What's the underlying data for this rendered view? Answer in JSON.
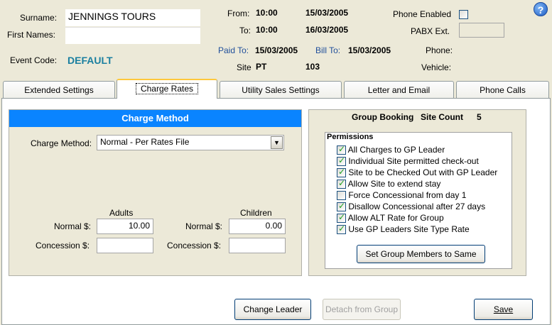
{
  "header": {
    "surname_label": "Surname:",
    "surname_value": "JENNINGS TOURS",
    "first_names_label": "First Names:",
    "first_names_value": "",
    "event_code_label": "Event Code:",
    "event_code_value": "DEFAULT",
    "from_label": "From:",
    "from_time": "10:00",
    "from_date": "15/03/2005",
    "to_label": "To:",
    "to_time": "10:00",
    "to_date": "16/03/2005",
    "paid_to_label": "Paid To:",
    "paid_to_value": "15/03/2005",
    "bill_to_label": "Bill To:",
    "bill_to_value": "15/03/2005",
    "site_label": "Site",
    "site_type": "PT",
    "site_number": "103",
    "phone_enabled_label": "Phone Enabled",
    "phone_enabled_checked": false,
    "pabx_label": "PABX Ext.",
    "pabx_value": "",
    "phone_label": "Phone:",
    "vehicle_label": "Vehicle:",
    "help_icon": "help-icon"
  },
  "tabs": [
    {
      "label": "Extended Settings"
    },
    {
      "label": "Charge Rates"
    },
    {
      "label": "Utility Sales Settings"
    },
    {
      "label": "Letter and Email"
    },
    {
      "label": "Phone Calls"
    }
  ],
  "active_tab": "Charge Rates",
  "charge_method": {
    "title": "Charge Method",
    "label": "Charge Method:",
    "selected": "Normal - Per Rates File",
    "adults_label": "Adults",
    "children_label": "Children",
    "adult_normal_label": "Normal $:",
    "adult_normal_value": "10.00",
    "adult_concession_label": "Concession $:",
    "adult_concession_value": "",
    "child_normal_label": "Normal $:",
    "child_normal_value": "0.00",
    "child_concession_label": "Concession $:",
    "child_concession_value": ""
  },
  "group_booking": {
    "title": "Group Booking",
    "site_count_label": "Site Count",
    "site_count_value": "5",
    "permissions_title": "Permissions",
    "permissions": [
      {
        "label": "All Charges to GP Leader",
        "checked": true
      },
      {
        "label": "Individual Site permitted check-out",
        "checked": true
      },
      {
        "label": "Site to be Checked Out with GP Leader",
        "checked": true
      },
      {
        "label": "Allow Site to extend stay",
        "checked": true
      },
      {
        "label": "Force Concessional from day 1",
        "checked": false
      },
      {
        "label": "Disallow Concessional after 27 days",
        "checked": true
      },
      {
        "label": "Allow ALT Rate for Group",
        "checked": true
      },
      {
        "label": "Use GP Leaders Site Type Rate",
        "checked": true
      }
    ],
    "set_members_button": "Set Group Members to Same"
  },
  "footer": {
    "change_leader_button": "Change Leader",
    "detach_button": "Detach from Group",
    "save_button": "Save"
  },
  "colors": {
    "window_bg": "#ece9d8",
    "section_header": "#0a84ff",
    "accent_teal": "#1a7fa0"
  }
}
